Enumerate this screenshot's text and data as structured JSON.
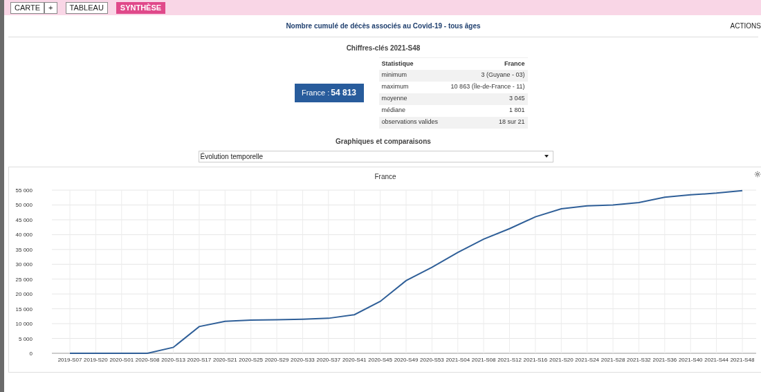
{
  "tabs": [
    {
      "label": "CARTE",
      "selected": false
    },
    {
      "label": "+",
      "selected": false
    },
    {
      "label": "TABLEAU",
      "selected": false
    },
    {
      "label": "SYNTHÈSE",
      "selected": true
    }
  ],
  "title": "Nombre cumulé de décès associés au Covid-19 - tous âges",
  "actions": "ACTIONS",
  "key_figures": {
    "title": "Chiffres-clés 2021-S48",
    "total_label": "France : ",
    "total_value": "54 813",
    "columns": [
      "Statistique",
      "France"
    ],
    "rows": [
      {
        "label": "minimum",
        "value": "3 (Guyane - 03)"
      },
      {
        "label": "maximum",
        "value": "10 863 (Île-de-France - 11)"
      },
      {
        "label": "moyenne",
        "value": "3 045"
      },
      {
        "label": "médiane",
        "value": "1 801"
      },
      {
        "label": "observations valides",
        "value": "18 sur 21"
      }
    ]
  },
  "charts_section": {
    "title": "Graphiques et comparaisons",
    "select_value": "Évolution temporelle"
  },
  "chart": {
    "chart_data": {
      "type": "line",
      "grid": true,
      "categories": [
        "2019-S07",
        "2019-S20",
        "2020-S01",
        "2020-S08",
        "2020-S13",
        "2020-S17",
        "2020-S21",
        "2020-S25",
        "2020-S29",
        "2020-S33",
        "2020-S37",
        "2020-S41",
        "2020-S45",
        "2020-S49",
        "2020-S53",
        "2021-S04",
        "2021-S08",
        "2021-S12",
        "2021-S16",
        "2021-S20",
        "2021-S24",
        "2021-S28",
        "2021-S32",
        "2021-S36",
        "2021-S40",
        "2021-S44",
        "2021-S48"
      ],
      "series": [
        {
          "name": "France",
          "color": "#2f5f98",
          "values": [
            0,
            0,
            0,
            0,
            2000,
            9000,
            10800,
            11200,
            11300,
            11500,
            11800,
            13000,
            17500,
            24500,
            29000,
            34000,
            38500,
            42000,
            46000,
            48700,
            49700,
            50000,
            50800,
            52600,
            53400,
            54000,
            54800
          ]
        }
      ],
      "ylim": [
        0,
        55000
      ],
      "yticks": [
        {
          "value": 0,
          "label": "0"
        },
        {
          "value": 5000,
          "label": "5 000"
        },
        {
          "value": 10000,
          "label": "10 000"
        },
        {
          "value": 15000,
          "label": "15 000"
        },
        {
          "value": 20000,
          "label": "20 000"
        },
        {
          "value": 25000,
          "label": "25 000"
        },
        {
          "value": 30000,
          "label": "30 000"
        },
        {
          "value": 35000,
          "label": "35 000"
        },
        {
          "value": 40000,
          "label": "40 000"
        },
        {
          "value": 45000,
          "label": "45 000"
        },
        {
          "value": 50000,
          "label": "50 000"
        },
        {
          "value": 55000,
          "label": "55 000"
        }
      ]
    }
  }
}
